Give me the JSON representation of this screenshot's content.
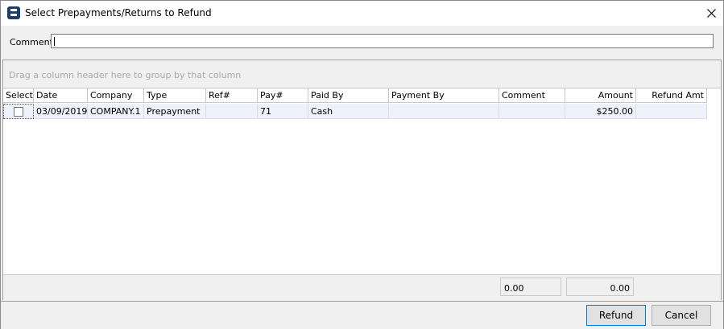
{
  "window": {
    "title": "Select Prepayments/Returns to Refund"
  },
  "comment": {
    "label": "Comment",
    "value": ""
  },
  "grid": {
    "group_hint": "Drag a column header here to group by that column",
    "columns": [
      "Select",
      "Date",
      "Company",
      "Type",
      "Ref#",
      "Pay#",
      "Paid By",
      "Payment By",
      "Comment",
      "Amount",
      "Refund Amt"
    ],
    "rows": [
      {
        "selected": false,
        "date": "03/09/2019",
        "company": "COMPANY.1",
        "type": "Prepayment",
        "ref": "",
        "pay": "71",
        "paid_by": "Cash",
        "payment_by": "",
        "comment": "",
        "amount": "$250.00",
        "refund_amt": ""
      }
    ],
    "totals": {
      "comment_total": "0.00",
      "amount_total": "0.00"
    }
  },
  "buttons": {
    "refund": "Refund",
    "cancel": "Cancel"
  }
}
